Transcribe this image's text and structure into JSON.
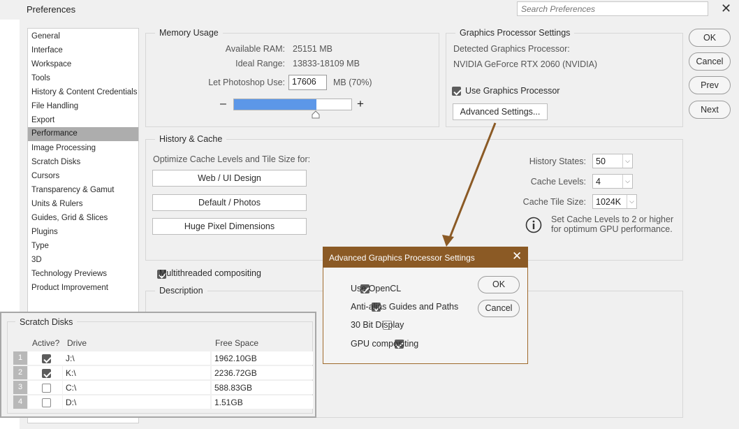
{
  "window": {
    "title": "Preferences",
    "search_placeholder": "Search Preferences"
  },
  "sidebar": {
    "items": [
      {
        "label": "General"
      },
      {
        "label": "Interface"
      },
      {
        "label": "Workspace"
      },
      {
        "label": "Tools"
      },
      {
        "label": "History & Content Credentials"
      },
      {
        "label": "File Handling"
      },
      {
        "label": "Export"
      },
      {
        "label": "Performance",
        "selected": true
      },
      {
        "label": "Image Processing"
      },
      {
        "label": "Scratch Disks"
      },
      {
        "label": "Cursors"
      },
      {
        "label": "Transparency & Gamut"
      },
      {
        "label": "Units & Rulers"
      },
      {
        "label": "Guides, Grid & Slices"
      },
      {
        "label": "Plugins"
      },
      {
        "label": "Type"
      },
      {
        "label": "3D"
      },
      {
        "label": "Technology Previews"
      },
      {
        "label": "Product Improvement"
      }
    ]
  },
  "memory": {
    "title": "Memory Usage",
    "available_label": "Available RAM:",
    "available_value": "25151 MB",
    "ideal_label": "Ideal Range:",
    "ideal_value": "13833-18109 MB",
    "use_label": "Let Photoshop Use:",
    "use_value": "17606",
    "use_suffix": "MB (70%)",
    "minus": "–",
    "plus": "+",
    "slider_fraction": 0.7
  },
  "gpu": {
    "title": "Graphics Processor Settings",
    "detected_label": "Detected Graphics Processor:",
    "detected_value": "NVIDIA GeForce RTX 2060 (NVIDIA)",
    "use_label": "Use Graphics Processor",
    "use_checked": true,
    "advanced_button": "Advanced Settings..."
  },
  "history_cache": {
    "title": "History & Cache",
    "optimize_label": "Optimize Cache Levels and Tile Size for:",
    "buttons": [
      "Web / UI Design",
      "Default / Photos",
      "Huge Pixel Dimensions"
    ],
    "states_label": "History States:",
    "states_value": "50",
    "levels_label": "Cache Levels:",
    "levels_value": "4",
    "tile_label": "Cache Tile Size:",
    "tile_value": "1024K",
    "info_line1": "Set Cache Levels to 2 or higher",
    "info_line2": "for optimum GPU performance."
  },
  "multithreaded": {
    "label": "Multithreaded compositing",
    "checked": true
  },
  "description": {
    "title": "Description"
  },
  "buttons": {
    "ok": "OK",
    "cancel": "Cancel",
    "prev": "Prev",
    "next": "Next"
  },
  "scratch_disks": {
    "title": "Scratch Disks",
    "headers": {
      "active": "Active?",
      "drive": "Drive",
      "free": "Free Space"
    },
    "rows": [
      {
        "num": "1",
        "active": true,
        "drive": "J:\\",
        "free": "1962.10GB"
      },
      {
        "num": "2",
        "active": true,
        "drive": "K:\\",
        "free": "2236.72GB"
      },
      {
        "num": "3",
        "active": false,
        "drive": "C:\\",
        "free": "588.83GB"
      },
      {
        "num": "4",
        "active": false,
        "drive": "D:\\",
        "free": "1.51GB"
      }
    ]
  },
  "advanced_dialog": {
    "title": "Advanced Graphics Processor Settings",
    "options": [
      {
        "label": "Use OpenCL",
        "checked": true
      },
      {
        "label": "Anti-alias Guides and Paths",
        "checked": true
      },
      {
        "label": "30 Bit Display",
        "checked": false
      },
      {
        "label": "GPU compositing",
        "checked": true
      }
    ],
    "ok": "OK",
    "cancel": "Cancel"
  },
  "colors": {
    "accent_blue": "#5c97e8",
    "dialog_header": "#8b5a25",
    "arrow": "#8b5a25",
    "selected_item": "#adadad"
  },
  "icons": [
    "close-icon",
    "info-icon",
    "chevron-down-icon",
    "checkbox-icon",
    "arrow-annotation"
  ]
}
